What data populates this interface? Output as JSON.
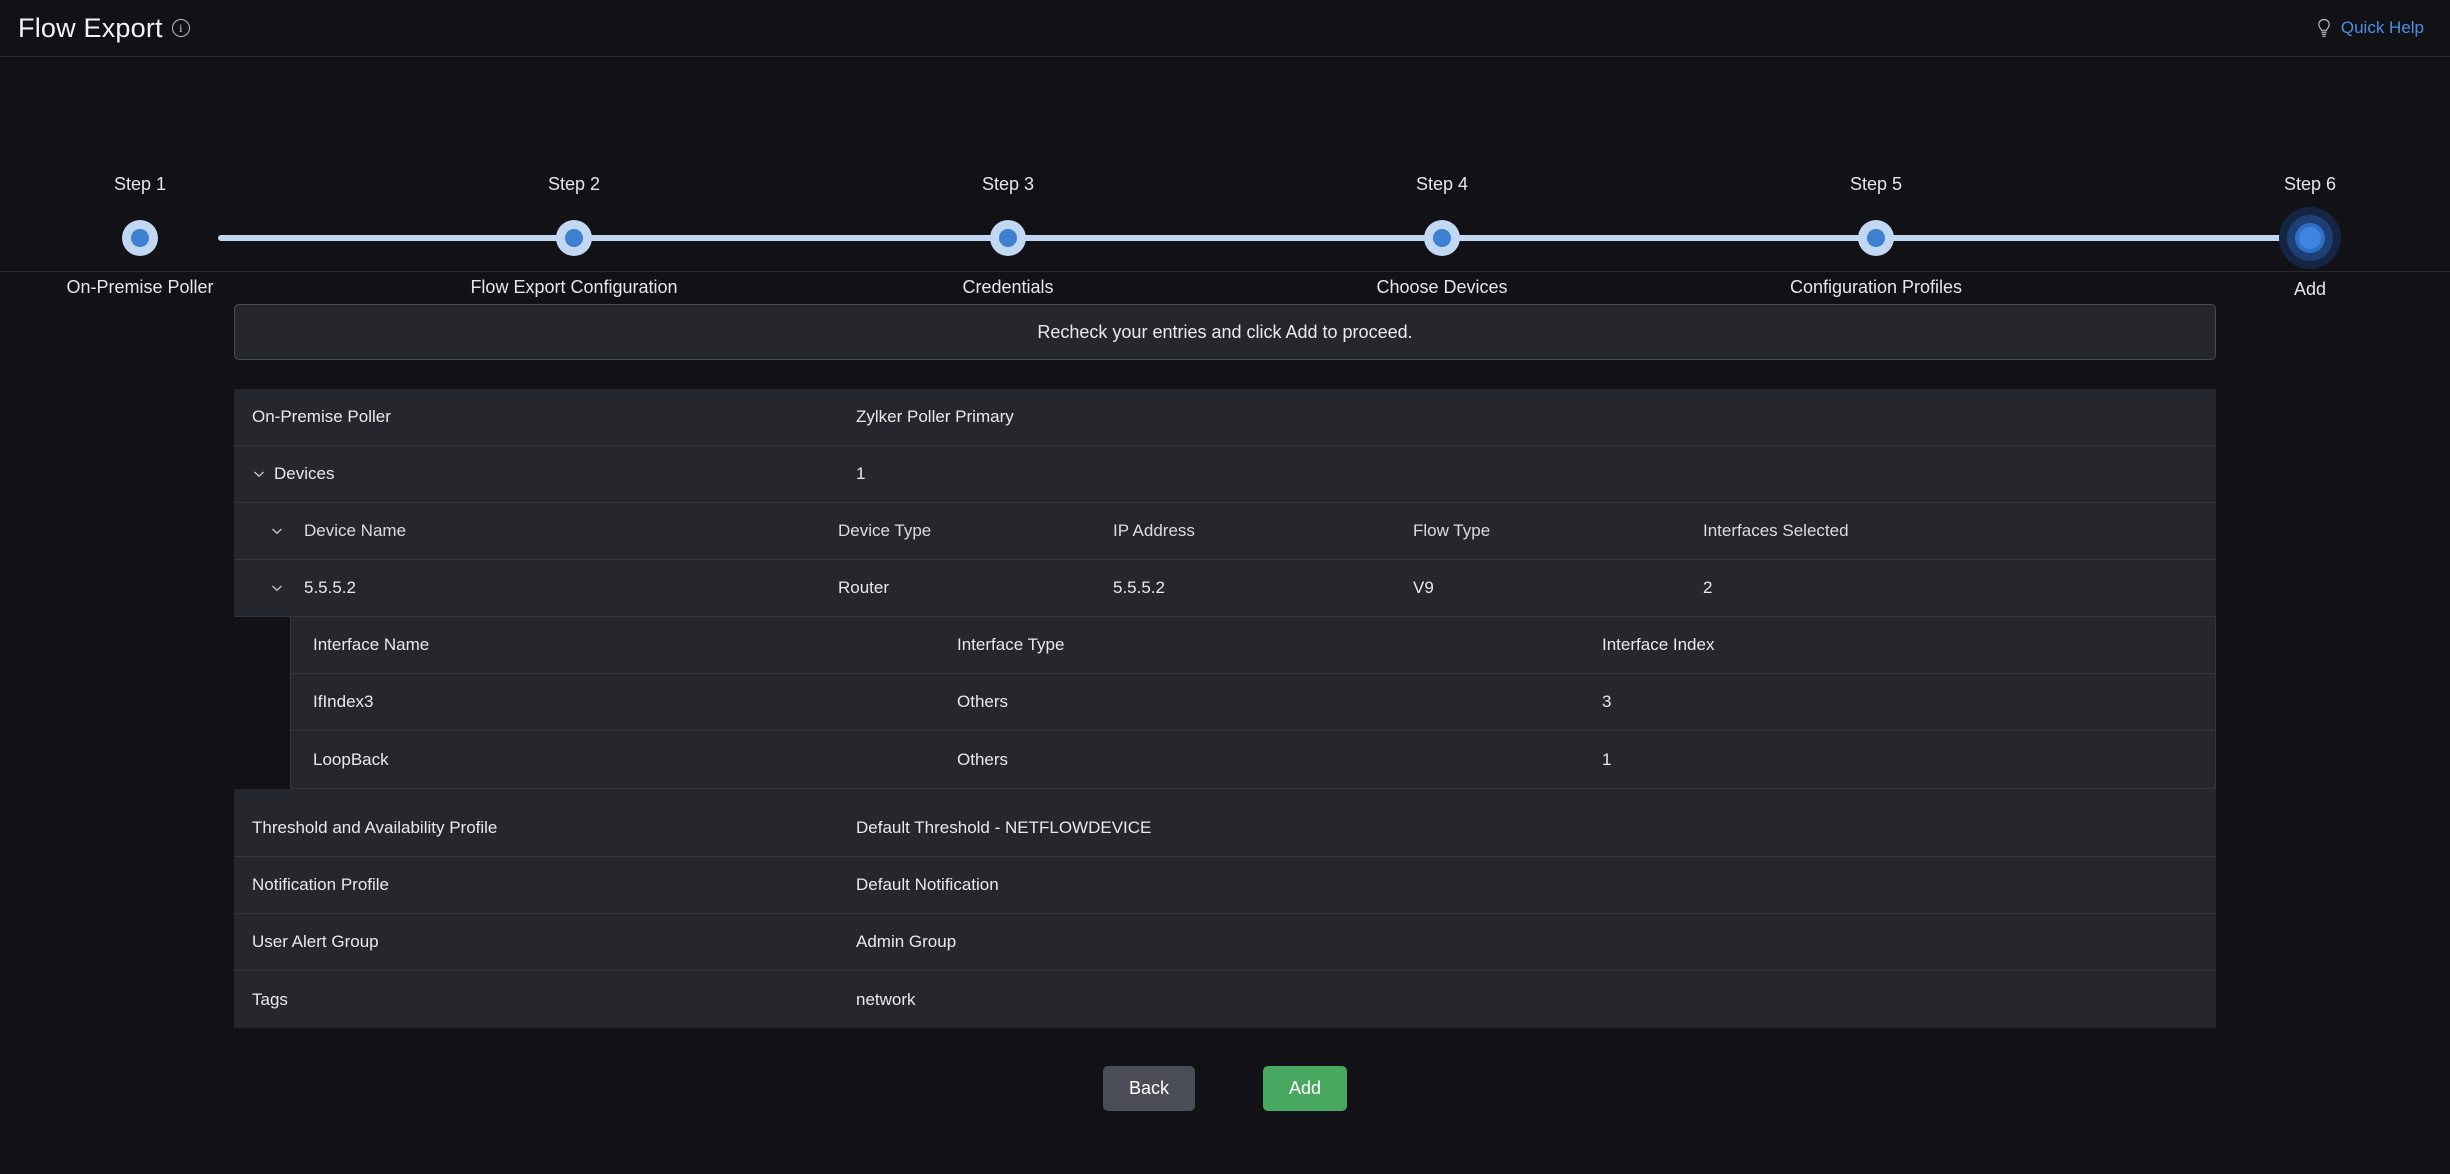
{
  "header": {
    "title": "Flow Export",
    "info_icon": "info-icon",
    "quick_help": {
      "label": "Quick Help",
      "icon": "lightbulb-icon",
      "color": "#4a90e8"
    }
  },
  "stepper": {
    "steps": [
      {
        "num": "Step 1",
        "label": "On-Premise Poller",
        "active": false
      },
      {
        "num": "Step 2",
        "label": "Flow Export Configuration",
        "active": false
      },
      {
        "num": "Step 3",
        "label": "Credentials",
        "active": false
      },
      {
        "num": "Step 4",
        "label": "Choose Devices",
        "active": false
      },
      {
        "num": "Step 5",
        "label": "Configuration Profiles",
        "active": false
      },
      {
        "num": "Step 6",
        "label": "Add",
        "active": true
      }
    ],
    "track_color": "#c2d8f2",
    "dot_color": "#3d7fd1"
  },
  "notice": {
    "text": "Recheck your entries and click Add to proceed."
  },
  "summary": {
    "poller": {
      "key": "On-Premise Poller",
      "value": "Zylker Poller Primary"
    },
    "devices": {
      "key": "Devices",
      "value": "1",
      "chevron": "chevron-down-icon"
    },
    "device_table": {
      "headers": {
        "name": "Device Name",
        "type": "Device Type",
        "ip": "IP Address",
        "flow": "Flow Type",
        "ifsel": "Interfaces Selected"
      },
      "row": {
        "name": "5.5.5.2",
        "type": "Router",
        "ip": "5.5.5.2",
        "flow": "V9",
        "ifsel": "2"
      }
    },
    "interface_table": {
      "headers": {
        "name": "Interface Name",
        "type": "Interface Type",
        "index": "Interface Index"
      },
      "rows": [
        {
          "name": "IfIndex3",
          "type": "Others",
          "index": "3"
        },
        {
          "name": "LoopBack",
          "type": "Others",
          "index": "1"
        }
      ]
    },
    "profiles": [
      {
        "key": "Threshold and Availability Profile",
        "value": "Default Threshold - NETFLOWDEVICE"
      },
      {
        "key": "Notification Profile",
        "value": "Default Notification"
      },
      {
        "key": "User Alert Group",
        "value": "Admin Group"
      },
      {
        "key": "Tags",
        "value": "network"
      }
    ]
  },
  "actions": {
    "back": {
      "label": "Back",
      "color": "#4a4d55"
    },
    "add": {
      "label": "Add",
      "color": "#49a860"
    }
  }
}
